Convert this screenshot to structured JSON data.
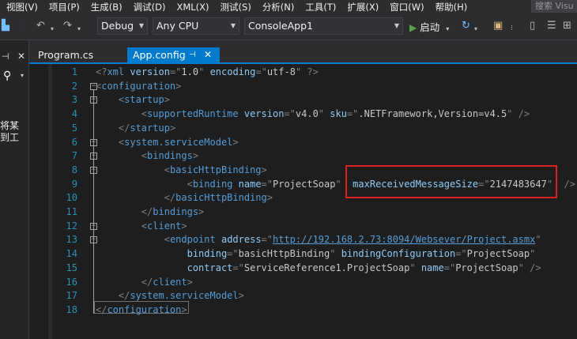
{
  "menu": {
    "items": [
      "视图(V)",
      "项目(P)",
      "生成(B)",
      "调试(D)",
      "XML(X)",
      "测试(S)",
      "分析(N)",
      "工具(T)",
      "扩展(X)",
      "窗口(W)",
      "帮助(H)"
    ],
    "search_placeholder": "搜索 Visu"
  },
  "toolbar": {
    "config": "Debug",
    "platform": "Any CPU",
    "project": "ConsoleApp1",
    "start_label": "启动"
  },
  "left_pane": {
    "text_line1": "将某",
    "text_line2": "到工"
  },
  "tabs": [
    {
      "label": "Program.cs",
      "active": false
    },
    {
      "label": "App.config",
      "active": true
    }
  ],
  "editor": {
    "lines": [
      {
        "n": "1",
        "html": "<span class=\"t-b\">&lt;?</span><span class=\"t-n\">xml</span> <span class=\"t-a\">version</span><span class=\"t-b\">=\"</span><span class=\"t-v\">1.0</span><span class=\"t-b\">\"</span> <span class=\"t-a\">encoding</span><span class=\"t-b\">=\"</span><span class=\"t-v\">utf-8</span><span class=\"t-b\">\" ?&gt;</span>"
      },
      {
        "n": "2",
        "html": "<span class=\"t-b\">&lt;</span><span class=\"t-n\">configuration</span><span class=\"t-b\">&gt;</span>"
      },
      {
        "n": "3",
        "html": "    <span class=\"t-b\">&lt;</span><span class=\"t-n\">startup</span><span class=\"t-b\">&gt;</span>"
      },
      {
        "n": "4",
        "html": "        <span class=\"t-b\">&lt;</span><span class=\"t-n\">supportedRuntime</span> <span class=\"t-a\">version</span><span class=\"t-b\">=\"</span><span class=\"t-v\">v4.0</span><span class=\"t-b\">\"</span> <span class=\"t-a\">sku</span><span class=\"t-b\">=\"</span><span class=\"t-v\">.NETFramework,Version=v4.5</span><span class=\"t-b\">\" /&gt;</span>"
      },
      {
        "n": "5",
        "html": "    <span class=\"t-b\">&lt;/</span><span class=\"t-n\">startup</span><span class=\"t-b\">&gt;</span>"
      },
      {
        "n": "6",
        "html": "    <span class=\"t-b\">&lt;</span><span class=\"t-n\">system.serviceModel</span><span class=\"t-b\">&gt;</span>"
      },
      {
        "n": "7",
        "html": "        <span class=\"t-b\">&lt;</span><span class=\"t-n\">bindings</span><span class=\"t-b\">&gt;</span>"
      },
      {
        "n": "8",
        "html": "            <span class=\"t-b\">&lt;</span><span class=\"t-n\">basicHttpBinding</span><span class=\"t-b\">&gt;</span>"
      },
      {
        "n": "9",
        "html": "                <span class=\"t-b\">&lt;</span><span class=\"t-n\">binding</span> <span class=\"t-a\">name</span><span class=\"t-b\">=\"</span><span class=\"t-v\">ProjectSoap</span><span class=\"t-b\">\"</span>  <span class=\"t-a\">maxReceivedMessageSize</span><span class=\"t-b\">=\"</span><span class=\"t-v\">2147483647</span><span class=\"t-b\">\"</span>  <span class=\"t-b\">/&gt;</span>"
      },
      {
        "n": "10",
        "html": "            <span class=\"t-b\">&lt;/</span><span class=\"t-n\">basicHttpBinding</span><span class=\"t-b\">&gt;</span>"
      },
      {
        "n": "11",
        "html": "        <span class=\"t-b\">&lt;/</span><span class=\"t-n\">bindings</span><span class=\"t-b\">&gt;</span>"
      },
      {
        "n": "12",
        "html": "        <span class=\"t-b\">&lt;</span><span class=\"t-n\">client</span><span class=\"t-b\">&gt;</span>"
      },
      {
        "n": "13",
        "html": "            <span class=\"t-b\">&lt;</span><span class=\"t-n\">endpoint</span> <span class=\"t-a\">address</span><span class=\"t-b\">=\"</span><span class=\"t-u\">http://192.168.2.73:8094/Websever/Project.asmx</span><span class=\"t-b\">\"</span>"
      },
      {
        "n": "14",
        "html": "                <span class=\"t-a\">binding</span><span class=\"t-b\">=\"</span><span class=\"t-v\">basicHttpBinding</span><span class=\"t-b\">\"</span> <span class=\"t-a\">bindingConfiguration</span><span class=\"t-b\">=\"</span><span class=\"t-v\">ProjectSoap</span><span class=\"t-b\">\"</span>"
      },
      {
        "n": "15",
        "html": "                <span class=\"t-a\">contract</span><span class=\"t-b\">=\"</span><span class=\"t-v\">ServiceReference1.ProjectSoap</span><span class=\"t-b\">\"</span> <span class=\"t-a\">name</span><span class=\"t-b\">=\"</span><span class=\"t-v\">ProjectSoap</span><span class=\"t-b\">\" /&gt;</span>"
      },
      {
        "n": "16",
        "html": "        <span class=\"t-b\">&lt;/</span><span class=\"t-n\">client</span><span class=\"t-b\">&gt;</span>"
      },
      {
        "n": "17",
        "html": "    <span class=\"t-b\">&lt;/</span><span class=\"t-n\">system.serviceModel</span><span class=\"t-b\">&gt;</span>"
      },
      {
        "n": "18",
        "html": "<span class=\"t-b\">&lt;/</span><span class=\"t-n\">configuration</span><span class=\"t-b\">&gt;</span>"
      }
    ]
  },
  "colors": {
    "accent": "#007acc",
    "highlight_box": "#e02020",
    "tag": "#569cd6",
    "attribute": "#92caf4",
    "line_number": "#2b91af"
  }
}
